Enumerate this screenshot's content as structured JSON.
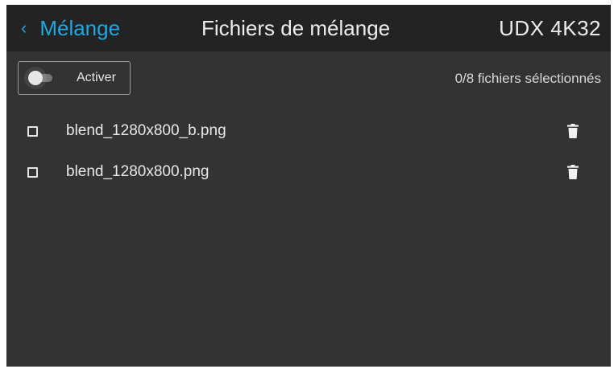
{
  "header": {
    "back_chevron": "‹",
    "back_label": "Mélange",
    "title": "Fichiers de mélange",
    "device": "UDX 4K32"
  },
  "toolbar": {
    "toggle_label": "Activer",
    "toggle_on": false,
    "selection_status": "0/8 fichiers sélectionnés"
  },
  "files": [
    {
      "name": "blend_1280x800_b.png",
      "checked": false
    },
    {
      "name": "blend_1280x800.png",
      "checked": false
    }
  ],
  "colors": {
    "accent": "#1ea7e1",
    "background": "#333333",
    "header_background": "#232323",
    "text": "#e8e8e8"
  },
  "icons": {
    "back": "chevron-left-icon",
    "delete": "trash-icon",
    "checkbox": "checkbox-icon"
  }
}
